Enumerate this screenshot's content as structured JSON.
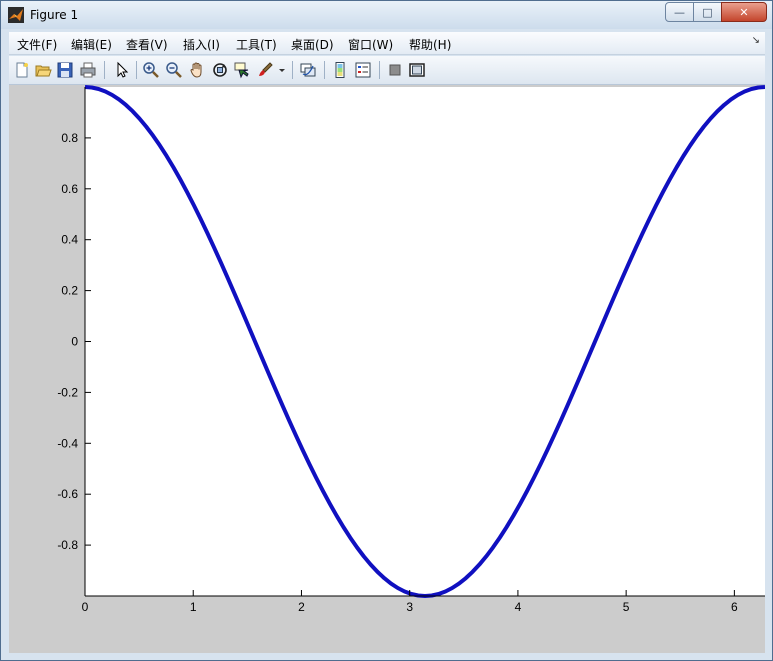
{
  "window": {
    "title": "Figure 1",
    "icon": "matlab-logo-icon",
    "controls": {
      "minimize": "—",
      "maximize": "□",
      "close": "✕"
    }
  },
  "menubar": {
    "items": [
      {
        "label": "文件(F)"
      },
      {
        "label": "编辑(E)"
      },
      {
        "label": "查看(V)"
      },
      {
        "label": "插入(I)"
      },
      {
        "label": "工具(T)"
      },
      {
        "label": "桌面(D)"
      },
      {
        "label": "窗口(W)"
      },
      {
        "label": "帮助(H)"
      }
    ],
    "overflow": "↘"
  },
  "toolbar": {
    "icons": [
      "new-figure-icon",
      "open-file-icon",
      "save-icon",
      "print-icon",
      "edit-plot-arrow-icon",
      "zoom-in-icon",
      "zoom-out-icon",
      "pan-hand-icon",
      "rotate-3d-icon",
      "data-cursor-icon",
      "brush-icon",
      "brush-dropdown-icon",
      "link-plot-icon",
      "colorbar-icon",
      "legend-icon",
      "hide-plot-tools-icon",
      "show-plot-tools-icon"
    ]
  },
  "colors": {
    "line": "#1010c0",
    "plot_bg": "#ffffff",
    "figure_bg": "#cccccc"
  },
  "chart_data": {
    "type": "line",
    "function": "cos(x)",
    "x_range": [
      0,
      6.283
    ],
    "xlim": [
      0,
      6.283
    ],
    "ylim": [
      -1,
      1
    ],
    "x_ticks": [
      0,
      1,
      2,
      3,
      4,
      5,
      6
    ],
    "x_tick_labels": [
      "0",
      "1",
      "2",
      "3",
      "4",
      "5",
      "6"
    ],
    "y_ticks": [
      0.8,
      0.6,
      0.4,
      0.2,
      0,
      -0.2,
      -0.4,
      -0.6,
      -0.8
    ],
    "y_tick_labels": [
      "0.8",
      "0.6",
      "0.4",
      "0.2",
      "0",
      "-0.2",
      "-0.4",
      "-0.6",
      "-0.8"
    ],
    "series": [
      {
        "color": "#1010c0",
        "line_width": 4,
        "samples": 100
      }
    ],
    "grid": false
  }
}
